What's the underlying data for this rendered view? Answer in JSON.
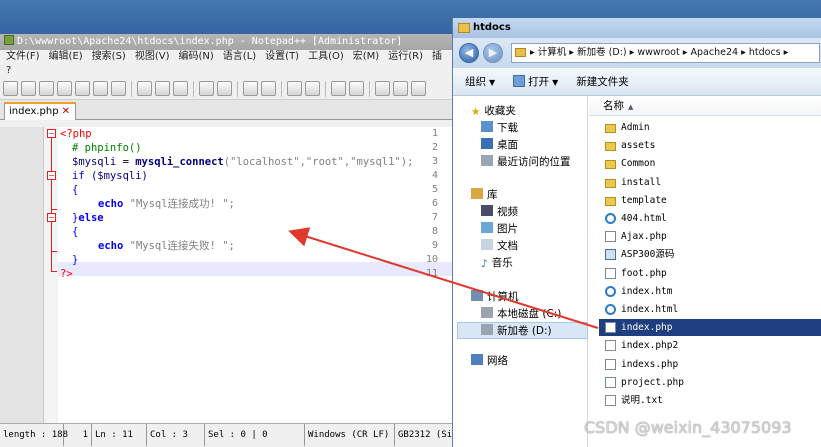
{
  "npp": {
    "title": "D:\\wwwroot\\Apache24\\htdocs\\index.php - Notepad++ [Administrator]",
    "menu": [
      "文件(F)",
      "编辑(E)",
      "搜索(S)",
      "视图(V)",
      "编码(N)",
      "语言(L)",
      "设置(T)",
      "工具(O)",
      "宏(M)",
      "运行(R)",
      "插"
    ],
    "menu_help": "?",
    "tab_label": "index.php",
    "tab_close": "✕",
    "line_numbers": [
      "1",
      "2",
      "3",
      "4",
      "5",
      "6",
      "7",
      "8",
      "9",
      "10",
      "11"
    ],
    "code": {
      "l1": "<?php",
      "l2": "# phpinfo()",
      "l3_var": "$mysqli",
      "l3_eq": " = ",
      "l3_fn": "mysqli_connect",
      "l3_args": "(\"localhost\",\"root\",\"mysql1\");",
      "l4_kw": "if",
      "l4_rest": " ($mysqli)",
      "l5": "{",
      "l6_kw": "echo",
      "l6_str": " \"Mysql连接成功! \";",
      "l7_brace": "}",
      "l7_kw": "else",
      "l8": "{",
      "l9_kw": "echo",
      "l9_str": " \"Mysql连接失败! \";",
      "l10": "}",
      "l11": "?>"
    },
    "status": {
      "length": "length : 188",
      "lines": "1",
      "ln": "Ln : 11",
      "col": "Col : 3",
      "sel": "Sel : 0 | 0",
      "eol": "Windows (CR LF)",
      "enc": "GB2312 (Si"
    }
  },
  "explorer": {
    "title": "htdocs",
    "back": "◀",
    "forward": "▶",
    "address": "▸ 计算机 ▸ 新加卷 (D:) ▸ wwwroot ▸ Apache24 ▸ htdocs ▸",
    "cmd": {
      "organize": "组织",
      "open": "打开",
      "new_folder": "新建文件夹"
    },
    "nav": {
      "favorites": "收藏夹",
      "downloads": "下载",
      "desktop": "桌面",
      "recent": "最近访问的位置",
      "library": "库",
      "videos": "视频",
      "pictures": "图片",
      "documents": "文档",
      "music": "音乐",
      "computer": "计算机",
      "local_disk": "本地磁盘 (C:)",
      "new_volume": "新加卷 (D:)",
      "network": "网络"
    },
    "col_name": "名称",
    "files": [
      {
        "name": "Admin",
        "type": "folder"
      },
      {
        "name": "assets",
        "type": "folder"
      },
      {
        "name": "Common",
        "type": "folder"
      },
      {
        "name": "install",
        "type": "folder"
      },
      {
        "name": "template",
        "type": "folder"
      },
      {
        "name": "404.html",
        "type": "ie"
      },
      {
        "name": "Ajax.php",
        "type": "doc"
      },
      {
        "name": "ASP300源码",
        "type": "asp"
      },
      {
        "name": "foot.php",
        "type": "doc"
      },
      {
        "name": "index.htm",
        "type": "ie"
      },
      {
        "name": "index.html",
        "type": "ie"
      },
      {
        "name": "index.php",
        "type": "doc",
        "selected": true
      },
      {
        "name": "index.php2",
        "type": "txt"
      },
      {
        "name": "indexs.php",
        "type": "doc"
      },
      {
        "name": "project.php",
        "type": "doc"
      },
      {
        "name": "说明.txt",
        "type": "txt"
      }
    ]
  },
  "watermark": "CSDN @weixin_43075093",
  "colors": {
    "keyword": "#0000ff",
    "string": "#808080",
    "comment": "#008000",
    "php_tag": "#ff0000",
    "function": "#000080",
    "variable": "#000080"
  }
}
